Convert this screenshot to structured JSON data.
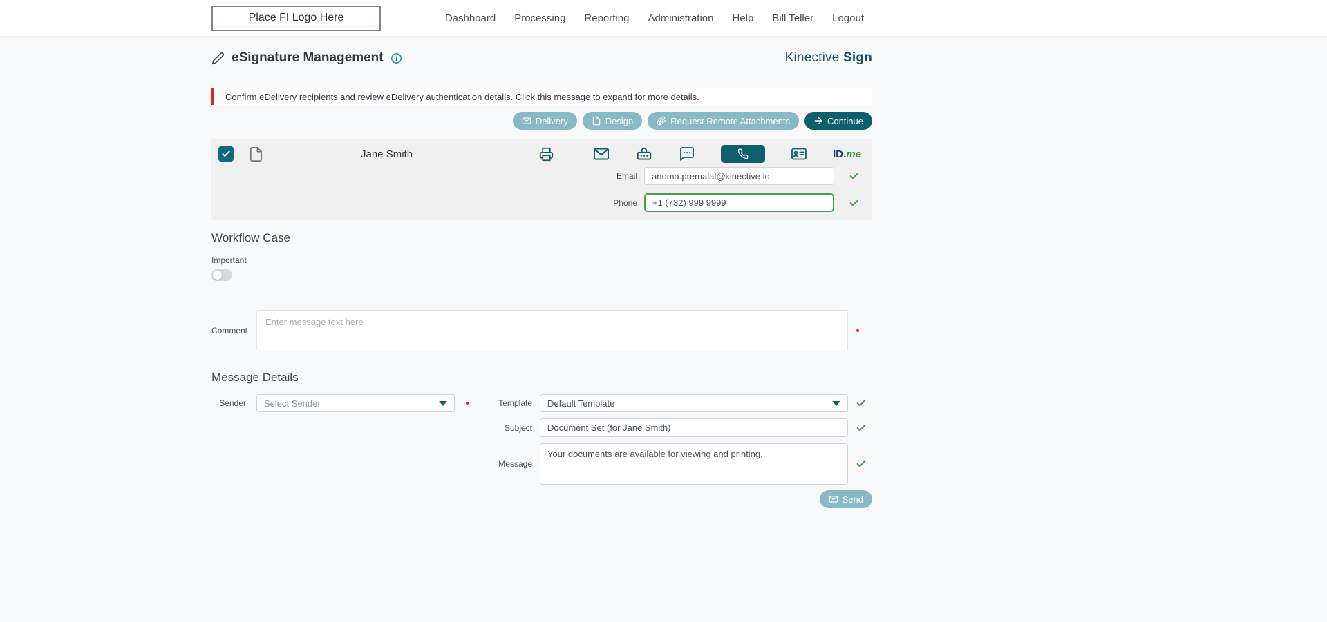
{
  "colors": {
    "accent_dark": "#0d5f6e",
    "accent_muted": "#87bac6",
    "success_green": "#43a047",
    "alert_red": "#e0231c",
    "brand_teal": "#155263"
  },
  "header": {
    "logo_placeholder": "Place FI Logo Here",
    "nav": [
      "Dashboard",
      "Processing",
      "Reporting",
      "Administration",
      "Help",
      "Bill Teller",
      "Logout"
    ]
  },
  "page": {
    "title": "eSignature Management",
    "brand_regular": "Kinective",
    "brand_bold": "Sign"
  },
  "alert": {
    "text": "Confirm eDelivery recipients and review eDelivery authentication details. Click this message to expand for more details."
  },
  "actions": {
    "delivery": "Delivery",
    "design": "Design",
    "request_remote_attachments": "Request Remote Attachments",
    "continue_label": "Continue"
  },
  "recipient": {
    "name": "Jane Smith",
    "email_label": "Email",
    "email_value": "anoma.premalal@kinective.io",
    "phone_label": "Phone",
    "phone_value": "+1 (732) 999 9999",
    "idme_id": "ID.",
    "idme_me": "me"
  },
  "workflow_case": {
    "heading": "Workflow Case",
    "important_label": "Important",
    "comment_label": "Comment",
    "comment_placeholder": "Enter message text here"
  },
  "message_details": {
    "heading": "Message Details",
    "sender_label": "Sender",
    "sender_placeholder": "Select Sender",
    "template_label": "Template",
    "template_value": "Default Template",
    "subject_label": "Subject",
    "subject_value": "Document Set (for Jane Smith)",
    "message_label": "Message",
    "message_value": "Your documents are available for viewing and printing.",
    "send": "Send"
  }
}
